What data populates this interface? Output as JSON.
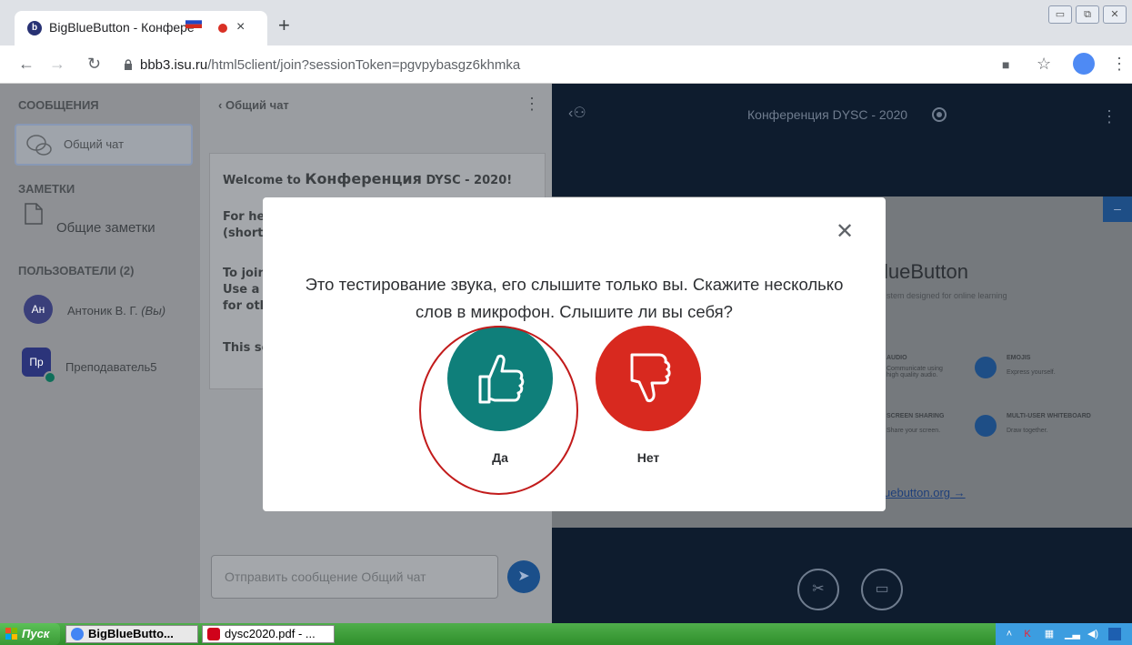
{
  "browser": {
    "tab_title": "BigBlueButton - Конфере",
    "tab_close": "×",
    "new_tab": "+",
    "url_host": "bbb3.isu.ru",
    "url_path": "/html5client/join?sessionToken=pgvpybasgz6khmka",
    "window_buttons": [
      "▭",
      "⧉",
      "✕"
    ]
  },
  "sidebar": {
    "messages_header": "СООБЩЕНИЯ",
    "public_chat": "Общий чат",
    "notes_header": "ЗАМЕТКИ",
    "shared_notes": "Общие заметки",
    "users_header": "ПОЛЬЗОВАТЕЛИ (2)",
    "users": [
      {
        "initials": "Ан",
        "name": "Антоник В. Г.",
        "suffix": "(Вы)"
      },
      {
        "initials": "Пр",
        "name": "Преподаватель5"
      }
    ]
  },
  "chat": {
    "title": "Общий чат",
    "welcome_prefix": "Welcome to ",
    "welcome_conf": "Конференция",
    "welcome_suffix": " DYSC - 2020!",
    "lines": [
      "For he",
      "(short",
      "To join",
      "Use a",
      "for oth",
      "This se"
    ],
    "input_placeholder": "Отправить сообщение Общий чат"
  },
  "main": {
    "title_conf": "Конференция",
    "title_rest": " DYSC - 2020",
    "slide_title": "lueButton",
    "slide_subtitle": "stem designed for online learning",
    "features": [
      {
        "label": "AUDIO",
        "desc": "Communicate using high quality audio."
      },
      {
        "label": "EMOJIS",
        "desc": "Express yourself."
      },
      {
        "label": "SCREEN SHARING",
        "desc": "Share your screen."
      },
      {
        "label": "MULTI-USER WHITEBOARD",
        "desc": "Draw together."
      }
    ],
    "slide_link": "uebutton.org →"
  },
  "modal": {
    "message": "Это тестирование звука, его слышите только вы. Скажите несколько слов в микрофон. Слышите ли вы себя?",
    "yes_label": "Да",
    "no_label": "Нет",
    "close_glyph": "✕",
    "yes_color": "#0f7f7a",
    "no_color": "#d8291f"
  },
  "taskbar": {
    "start": "Пуск",
    "tasks": [
      "BigBlueButto...",
      "dysc2020.pdf - ..."
    ]
  }
}
